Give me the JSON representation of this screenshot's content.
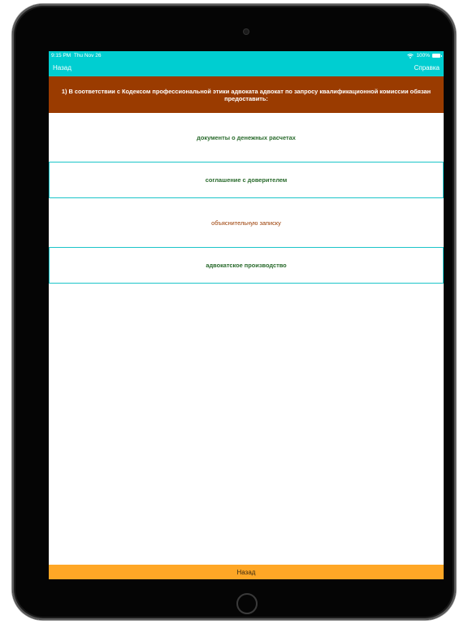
{
  "status_bar": {
    "time": "9:15 PM",
    "date": "Thu Nov 26",
    "battery": "100%"
  },
  "nav": {
    "back_label": "Назад",
    "help_label": "Справка"
  },
  "question": {
    "text": "1) В соответствии с Кодексом профессиональной этики адвоката адвокат по запросу квалификационной комиссии обязан предоставить:"
  },
  "answers": [
    {
      "label": "документы о денежных расчетах"
    },
    {
      "label": "соглашение с доверителем"
    },
    {
      "label": "объяснительную записку"
    },
    {
      "label": "адвокатское производство"
    }
  ],
  "bottom_bar": {
    "label": "Назад"
  },
  "colors": {
    "accent": "#00ced1",
    "question_bg": "#9a3b00",
    "bottom_bar_bg": "#ffa726",
    "answer_text": "#2a6b2d"
  }
}
